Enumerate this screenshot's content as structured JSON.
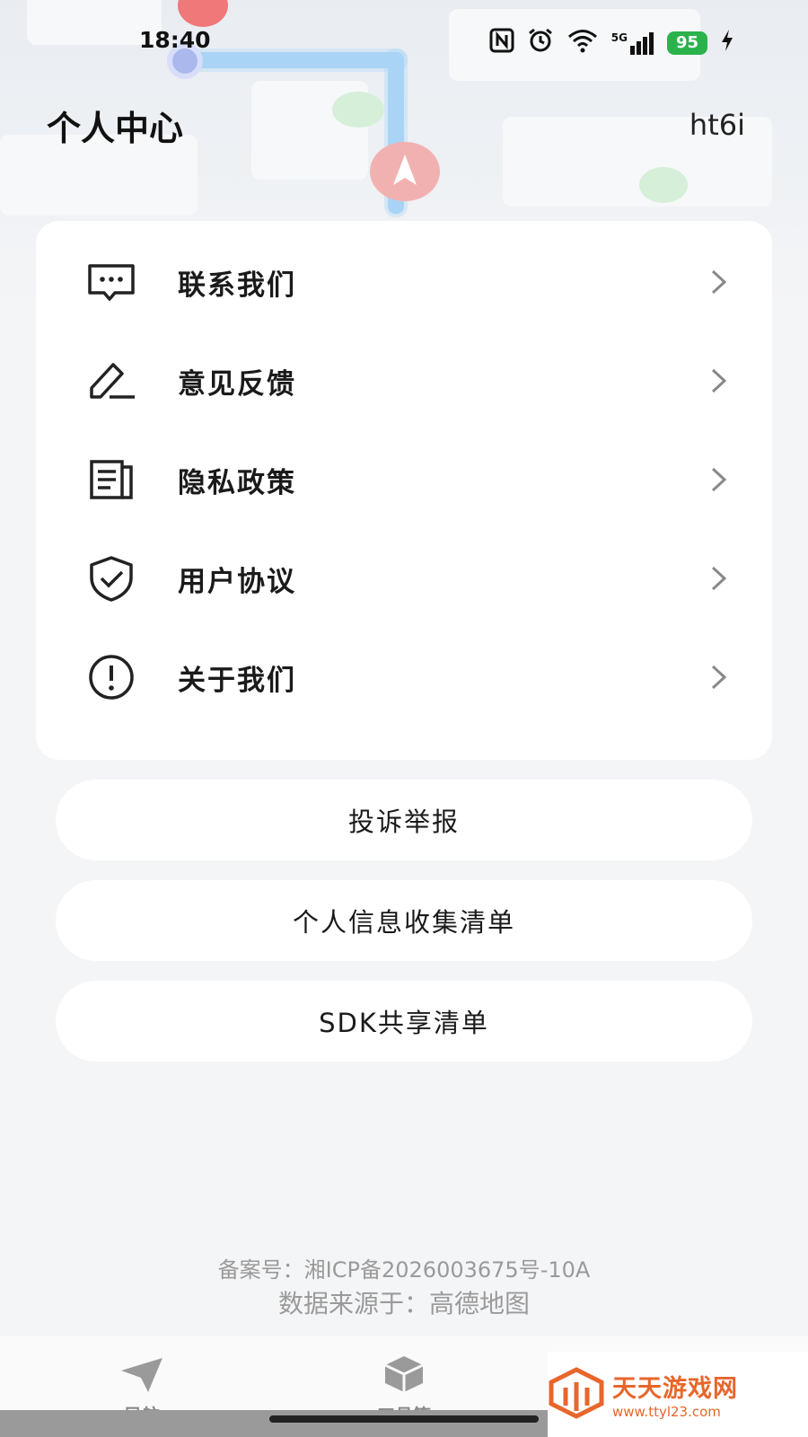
{
  "status_bar": {
    "time": "18:40",
    "network": "5G",
    "battery": "95"
  },
  "header": {
    "title": "个人中心",
    "user_name": "ht6i"
  },
  "menu": {
    "items": [
      {
        "label": "联系我们",
        "icon": "chat-icon"
      },
      {
        "label": "意见反馈",
        "icon": "edit-icon"
      },
      {
        "label": "隐私政策",
        "icon": "document-icon"
      },
      {
        "label": "用户协议",
        "icon": "shield-check-icon"
      },
      {
        "label": "关于我们",
        "icon": "info-icon"
      }
    ]
  },
  "buttons": {
    "complaint": "投诉举报",
    "personal_info": "个人信息收集清单",
    "sdk_share": "SDK共享清单"
  },
  "footer": {
    "icp": "备案号：湘ICP备2026003675号-10A",
    "data_source": "数据来源于：高德地图"
  },
  "tabbar": {
    "tabs": [
      {
        "label": "导航"
      },
      {
        "label": "工具箱"
      }
    ]
  },
  "watermark": {
    "title": "天天游戏网",
    "url": "www.ttyl23.com"
  },
  "colors": {
    "accent_green": "#2bb24c",
    "route_blue": "#a9d4f5",
    "watermark_orange": "#e8662c"
  }
}
